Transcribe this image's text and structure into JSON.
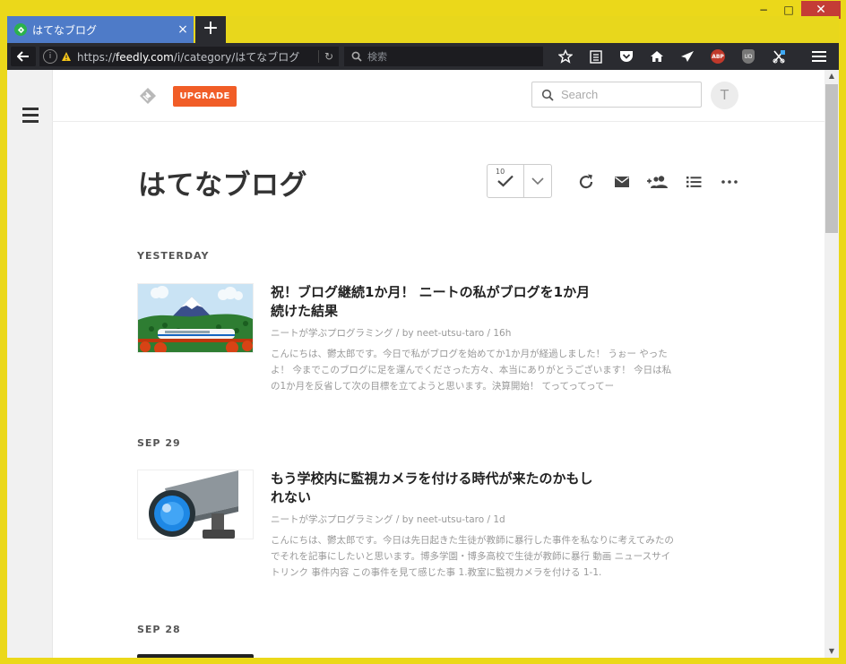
{
  "window": {
    "minimize": "−",
    "maximize": "□",
    "close": "✕"
  },
  "tab": {
    "title": "はてなブログ",
    "close": "×",
    "new_tab": "+"
  },
  "navbar": {
    "url_scheme": "https://",
    "url_domain": "feedly.com",
    "url_path": "/i/category/はてなブログ",
    "search_placeholder": "検索",
    "abp_label": "ABP",
    "ub_label": "UD"
  },
  "header": {
    "upgrade_label": "UPGRADE",
    "search_placeholder": "Search",
    "avatar_initial": "T"
  },
  "page": {
    "title": "はてなブログ",
    "unread_count": "10"
  },
  "sections": [
    {
      "label": "YESTERDAY"
    },
    {
      "label": "SEP 29"
    },
    {
      "label": "SEP 28"
    }
  ],
  "entries": [
    {
      "title": "祝！ブログ継続1か月！ ニートの私がブログを1か月続けた結果",
      "meta": "ニートが学ぶプログラミング / by neet-utsu-taro / 16h",
      "summary": "こんにちは、鬱太郎です。今日で私がブログを始めてか1か月が経過しました！ うぉー やったよ！ 今までこのブログに足を運んでくださった方々、本当にありがとうございます！ 今日は私の1か月を反省して次の目標を立てようと思います。決算開始！ てってってってー"
    },
    {
      "title": "もう学校内に監視カメラを付ける時代が来たのかもしれない",
      "meta": "ニートが学ぶプログラミング / by neet-utsu-taro / 1d",
      "summary": "こんにちは、鬱太郎です。今日は先日起きた生徒が教師に暴行した事件を私なりに考えてみたのでそれを記事にしたいと思います。博多学園・博多高校で生徒が教師に暴行 動画 ニュースサイトリンク 事件内容 この事件を見て感じた事 1.教室に監視カメラを付ける 1-1."
    }
  ],
  "colors": {
    "accent": "#f15d27",
    "tab": "#4e7bc8",
    "toolbar": "#2a2b30",
    "frame": "#ebd81a",
    "feedly_green": "#2bb24c"
  }
}
